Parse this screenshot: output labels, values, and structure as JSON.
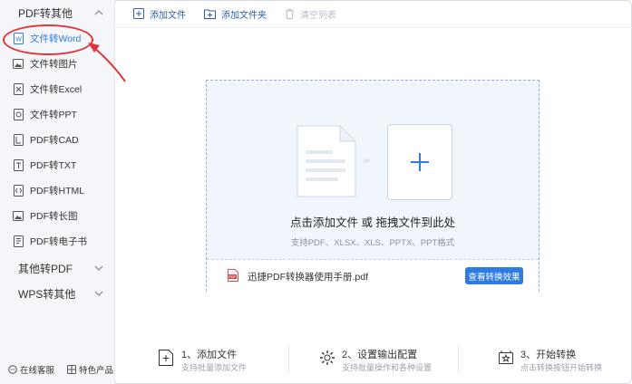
{
  "sidebar": {
    "group1": {
      "label": "PDF转其他"
    },
    "items": [
      {
        "label": "文件转Word",
        "icon": "word-icon"
      },
      {
        "label": "文件转图片",
        "icon": "image-icon"
      },
      {
        "label": "文件转Excel",
        "icon": "excel-icon"
      },
      {
        "label": "文件转PPT",
        "icon": "ppt-icon"
      },
      {
        "label": "PDF转CAD",
        "icon": "cad-icon"
      },
      {
        "label": "PDF转TXT",
        "icon": "txt-icon"
      },
      {
        "label": "PDF转HTML",
        "icon": "html-icon"
      },
      {
        "label": "PDF转长图",
        "icon": "long-image-icon"
      },
      {
        "label": "PDF转电子书",
        "icon": "ebook-icon"
      }
    ],
    "group2": {
      "label": "其他转PDF"
    },
    "group3": {
      "label": "WPS转其他"
    },
    "footer": {
      "support": "在线客服",
      "features": "特色产品"
    }
  },
  "toolbar": {
    "add_file": "添加文件",
    "add_folder": "添加文件夹",
    "clear_list": "清空列表"
  },
  "dropzone": {
    "main_text": "点击添加文件 或 拖拽文件到此处",
    "sub_text": "支持PDF、XLSX、XLS、PPTX、PPT格式",
    "file_name": "迅捷PDF转换器使用手册.pdf",
    "view_button": "查看转换效果",
    "pdf_badge": "PDF"
  },
  "steps": [
    {
      "title": "1、添加文件",
      "desc": "支持批量添加文件"
    },
    {
      "title": "2、设置输出配置",
      "desc": "支持批量操作和各种设置"
    },
    {
      "title": "3、开始转换",
      "desc": "点击转换按钮开始转换"
    }
  ],
  "colors": {
    "accent": "#2f7ce0",
    "annotation": "#e0353b"
  }
}
